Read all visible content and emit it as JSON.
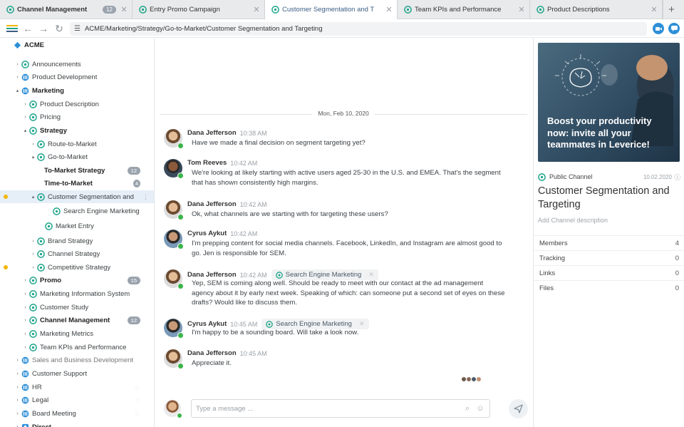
{
  "tabs": [
    {
      "label": "Channel Management",
      "badge": "12",
      "active": false
    },
    {
      "label": "Entry Promo Campaign",
      "badge": "",
      "active": false
    },
    {
      "label": "Customer Segmentation and T",
      "badge": "",
      "active": true
    },
    {
      "label": "Team KPIs and Performance",
      "badge": "",
      "active": false
    },
    {
      "label": "Product Descriptions",
      "badge": "",
      "active": false
    }
  ],
  "new_tab_label": "+",
  "toolbar": {
    "address": "ACME/Marketing/Strategy/Go-to-Market/Customer Segmentation and Targeting"
  },
  "sidebar": {
    "root": "ACME",
    "items": [
      {
        "label": "Announcements",
        "badge": ""
      },
      {
        "label": "Product Development",
        "badge": ""
      },
      {
        "label": "Marketing",
        "badge": ""
      },
      {
        "label": "Product Description",
        "badge": ""
      },
      {
        "label": "Pricing",
        "badge": ""
      },
      {
        "label": "Strategy",
        "badge": ""
      },
      {
        "label": "Route-to-Market",
        "badge": ""
      },
      {
        "label": "Go-to-Market",
        "badge": ""
      },
      {
        "label": "To-Market Strategy",
        "badge": "12"
      },
      {
        "label": "Time-to-Market",
        "badge": "4"
      },
      {
        "label": "Customer Segmentation and",
        "badge": ""
      },
      {
        "label": "Search Engine Marketing",
        "badge": ""
      },
      {
        "label": "Market Entry",
        "badge": ""
      },
      {
        "label": "Brand Strategy",
        "badge": ""
      },
      {
        "label": "Channel Strategy",
        "badge": ""
      },
      {
        "label": "Competitive Strategy",
        "badge": ""
      },
      {
        "label": "Promo",
        "badge": "15"
      },
      {
        "label": "Marketing Information System",
        "badge": ""
      },
      {
        "label": "Customer Study",
        "badge": ""
      },
      {
        "label": "Channel Management",
        "badge": "12"
      },
      {
        "label": "Marketing Metrics",
        "badge": ""
      },
      {
        "label": "Team KPIs and Performance",
        "badge": ""
      },
      {
        "label": "Sales and Business Development",
        "badge": ""
      },
      {
        "label": "Customer Support",
        "badge": ""
      },
      {
        "label": "HR",
        "badge": ""
      },
      {
        "label": "Legal",
        "badge": ""
      },
      {
        "label": "Board Meeting",
        "badge": ""
      },
      {
        "label": "Direct",
        "badge": ""
      }
    ]
  },
  "chat": {
    "date": "Mon, Feb 10, 2020",
    "messages": [
      {
        "name": "Dana Jefferson",
        "time": "10:38 AM",
        "tag": "",
        "text": "Have we made a final decision on segment targeting yet?"
      },
      {
        "name": "Tom Reeves",
        "time": "10:42 AM",
        "tag": "",
        "text": "We're looking at likely starting with active users aged 25-30 in the U.S. and EMEA. That's the segment that has shown consistently high margins."
      },
      {
        "name": "Dana Jefferson",
        "time": "10:42 AM",
        "tag": "",
        "text": "Ok, what channels are we starting with for targeting these users?"
      },
      {
        "name": "Cyrus Aykut",
        "time": "10:42 AM",
        "tag": "",
        "text": "I'm prepping content for social media channels. Facebook, LinkedIn, and Instagram are almost good to go. Jen is responsible for SEM."
      },
      {
        "name": "Dana Jefferson",
        "time": "10:42 AM",
        "tag": "Search Engine Marketing",
        "text": "Yep, SEM is coming along well. Should be ready to meet with our contact at the ad management agency about it by early next week. Speaking of which: can someone put a second set of eyes on these drafts? Would like to discuss them."
      },
      {
        "name": "Cyrus Aykut",
        "time": "10:45 AM",
        "tag": "Search Engine Marketing",
        "text": "I'm happy to be a sounding board. Will take a look now."
      },
      {
        "name": "Dana Jefferson",
        "time": "10:45 AM",
        "tag": "",
        "text": "Appreciate it."
      }
    ],
    "composer_placeholder": "Type a message ..."
  },
  "panel": {
    "promo_text": "Boost your productivity now: invite all your teammates in Leverice!",
    "channel_type": "Public Channel",
    "channel_date": "10.02.2020",
    "title": "Customer Segmentation and Targeting",
    "description_placeholder": "Add Channel description",
    "stats": [
      {
        "label": "Members",
        "value": "4"
      },
      {
        "label": "Tracking",
        "value": "0"
      },
      {
        "label": "Links",
        "value": "0"
      },
      {
        "label": "Files",
        "value": "0"
      }
    ]
  },
  "colors": {
    "accent": "#2e8fd8",
    "channel_icon": "#1fa58b",
    "online": "#3bb54a",
    "badge": "#9aa3ad"
  },
  "icons": {
    "channel": "channel-icon",
    "group": "group-icon",
    "send": "send-icon",
    "attach": "paperclip-icon",
    "emoji": "emoji-icon"
  }
}
